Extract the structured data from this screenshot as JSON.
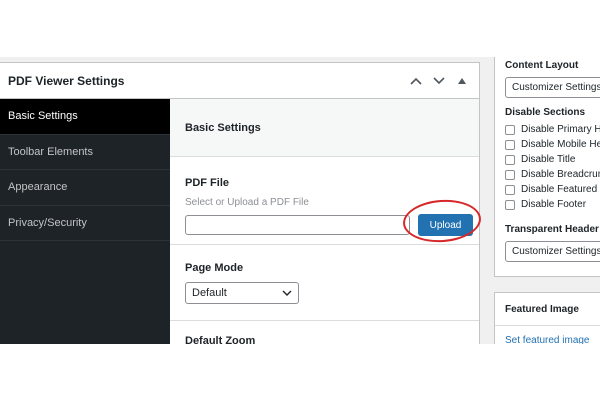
{
  "metabox": {
    "title": "PDF Viewer Settings",
    "tabs": [
      {
        "label": "Basic Settings"
      },
      {
        "label": "Toolbar Elements"
      },
      {
        "label": "Appearance"
      },
      {
        "label": "Privacy/Security"
      }
    ]
  },
  "content": {
    "section_title": "Basic Settings",
    "pdf_file": {
      "label": "PDF File",
      "description": "Select or Upload a PDF File",
      "value": "",
      "upload_label": "Upload"
    },
    "page_mode": {
      "label": "Page Mode",
      "selected": "Default"
    },
    "default_zoom": {
      "label": "Default Zoom"
    }
  },
  "sidebar": {
    "content_layout": {
      "heading": "Content Layout",
      "selected": "Customizer Settings"
    },
    "disable_sections": {
      "heading": "Disable Sections",
      "items": [
        {
          "label": "Disable Primary Header"
        },
        {
          "label": "Disable Mobile Header"
        },
        {
          "label": "Disable Title"
        },
        {
          "label": "Disable Breadcrumb"
        },
        {
          "label": "Disable Featured Image"
        },
        {
          "label": "Disable Footer"
        }
      ]
    },
    "transparent_header": {
      "heading": "Transparent Header",
      "selected": "Customizer Settings"
    },
    "featured_image": {
      "heading": "Featured Image",
      "link": "Set featured image"
    }
  },
  "colors": {
    "accent": "#2271b1",
    "annotation": "#d62828",
    "tab_background": "#1d2327"
  }
}
